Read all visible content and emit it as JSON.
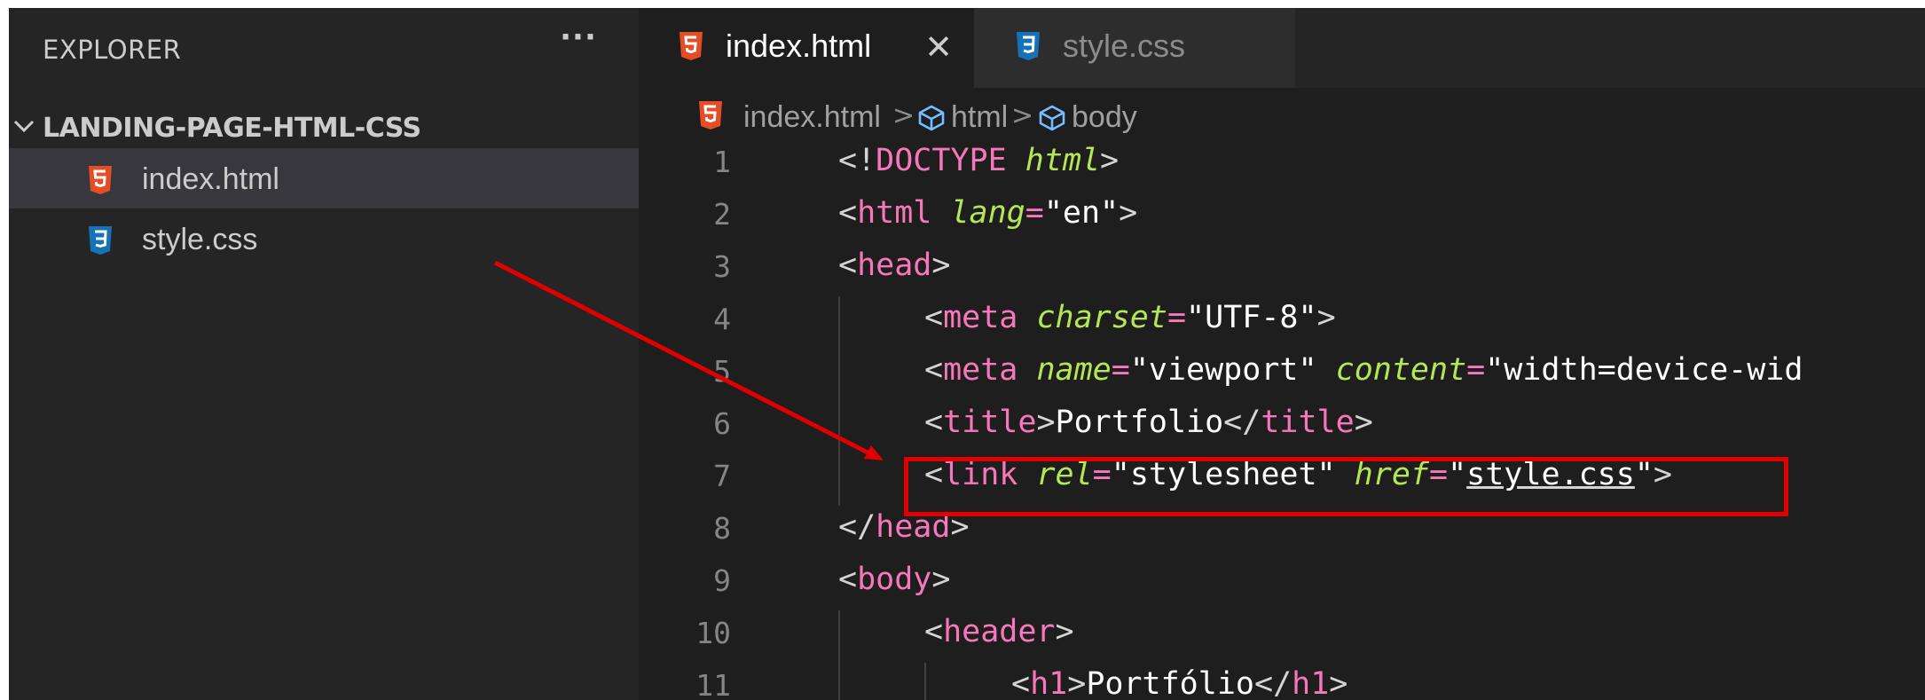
{
  "sidebar": {
    "title": "EXPLORER",
    "more_label": "···",
    "folder": "LANDING-PAGE-HTML-CSS",
    "files": [
      {
        "name": "index.html",
        "icon": "html5-icon",
        "active": true
      },
      {
        "name": "style.css",
        "icon": "css3-icon",
        "active": false
      }
    ]
  },
  "tabs": [
    {
      "label": "index.html",
      "icon": "html5-icon",
      "active": true,
      "close": "✕"
    },
    {
      "label": "style.css",
      "icon": "css3-icon",
      "active": false
    }
  ],
  "breadcrumb": {
    "file": "index.html",
    "separator": ">",
    "items": [
      "html",
      "body"
    ]
  },
  "editor": {
    "lines": [
      {
        "n": "1",
        "text": "<!DOCTYPE html>"
      },
      {
        "n": "2",
        "text": "<html lang=\"en\">"
      },
      {
        "n": "3",
        "text": "<head>"
      },
      {
        "n": "4",
        "text": "<meta charset=\"UTF-8\">"
      },
      {
        "n": "5",
        "text": "<meta name=\"viewport\" content=\"width=device-wid"
      },
      {
        "n": "6",
        "text": "<title>Portfolio</title>"
      },
      {
        "n": "7",
        "text": "<link rel=\"stylesheet\" href=\"style.css\">"
      },
      {
        "n": "8",
        "text": "</head>"
      },
      {
        "n": "9",
        "text": "<body>"
      },
      {
        "n": "10",
        "text": "<header>"
      },
      {
        "n": "11",
        "text": "<h1>Portfólio</h1>"
      }
    ]
  },
  "colors": {
    "html5": "#e44d26",
    "css3": "#1572b6",
    "tag": "#f778ba",
    "attribute": "#b5e655",
    "annotation": "#e00000"
  }
}
